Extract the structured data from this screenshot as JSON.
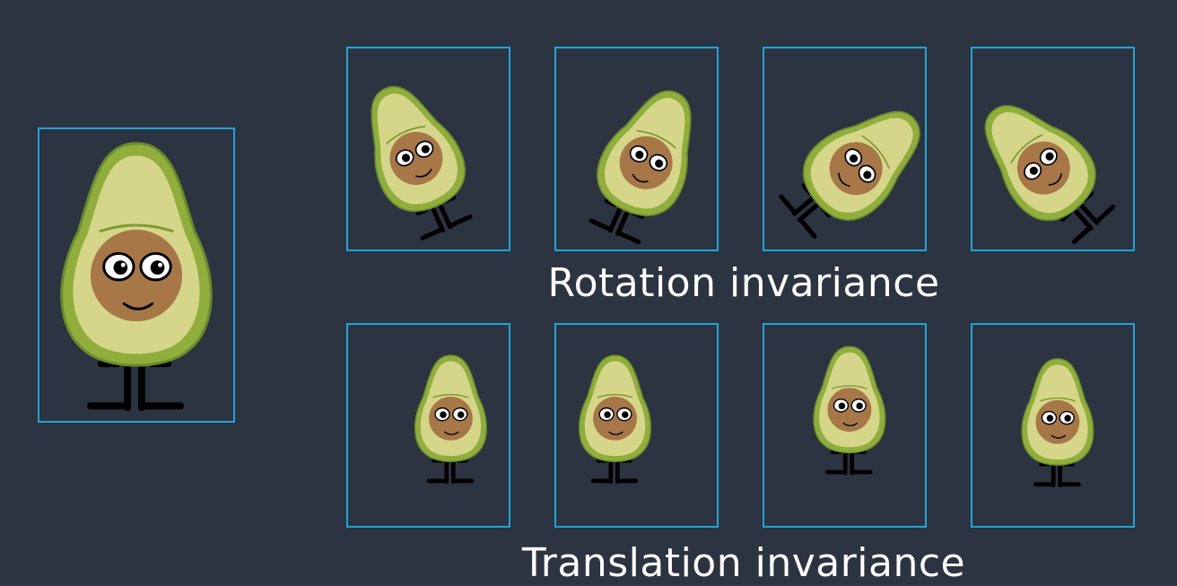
{
  "captions": {
    "rotation": "Rotation invariance",
    "translation": "Translation invariance"
  },
  "colors": {
    "background": "#2b3440",
    "frame_border": "#1ea4d6",
    "avocado_skin": "#8fae3b",
    "avocado_flesh": "#d5d68a",
    "pit": "#a87747",
    "limb": "#111111"
  },
  "icons": {
    "character": "avocado-character"
  }
}
